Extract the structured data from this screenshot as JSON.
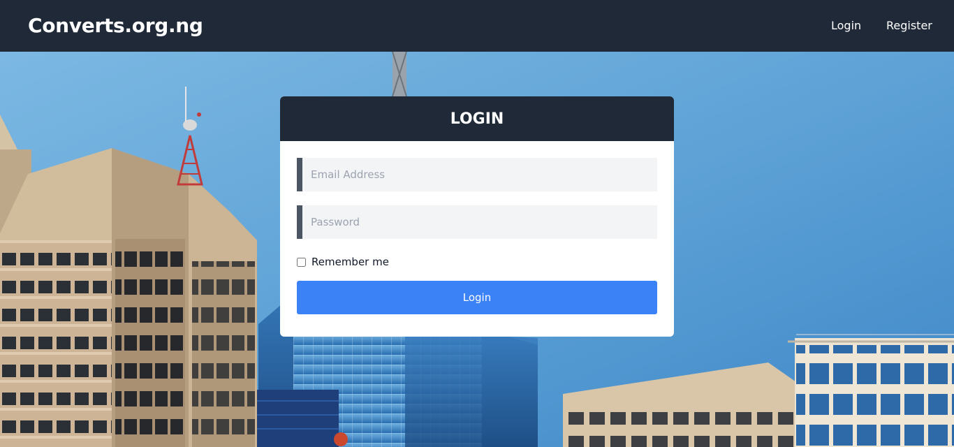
{
  "navbar": {
    "brand": "Converts.org.ng",
    "links": [
      "Login",
      "Register"
    ]
  },
  "login_card": {
    "title": "LOGIN",
    "email_placeholder": "Email Address",
    "password_placeholder": "Password",
    "remember_label": "Remember me",
    "remember_checked": false,
    "submit_label": "Login"
  },
  "colors": {
    "navbar_bg": "#1f2937",
    "card_header_bg": "#1f2937",
    "field_bg": "#f3f4f6",
    "field_accent": "#4b5563",
    "button_bg": "#3b82f6"
  }
}
